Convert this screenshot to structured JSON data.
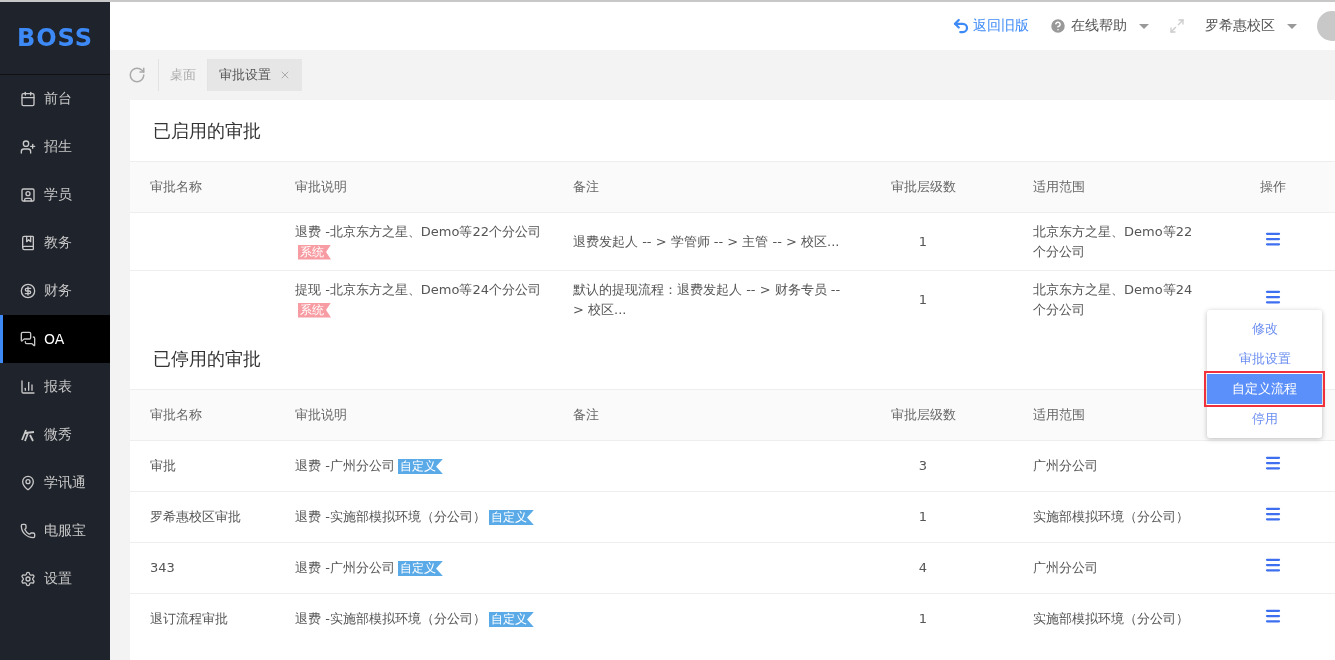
{
  "logo": "BOSS",
  "sidebar": {
    "items": [
      {
        "label": "前台",
        "selected": false
      },
      {
        "label": "招生",
        "selected": false
      },
      {
        "label": "学员",
        "selected": false
      },
      {
        "label": "教务",
        "selected": false
      },
      {
        "label": "财务",
        "selected": false
      },
      {
        "label": "OA",
        "selected": true
      },
      {
        "label": "报表",
        "selected": false
      },
      {
        "label": "微秀",
        "selected": false
      },
      {
        "label": "学讯通",
        "selected": false
      },
      {
        "label": "电服宝",
        "selected": false
      },
      {
        "label": "设置",
        "selected": false
      }
    ]
  },
  "topbar": {
    "back_link": "返回旧版",
    "help": "在线帮助",
    "campus": "罗希惠校区"
  },
  "tabs": [
    {
      "label": "桌面",
      "selected": false,
      "closable": false
    },
    {
      "label": "审批设置",
      "selected": true,
      "closable": true
    }
  ],
  "sections": [
    {
      "title": "已启用的审批",
      "columns": [
        "审批名称",
        "审批说明",
        "备注",
        "审批层级数",
        "适用范围",
        "操作"
      ],
      "rows": [
        {
          "description": "退费 -北京东方之星、Demo等22个分公司",
          "tag": {
            "text": "系统",
            "kind": "system"
          },
          "remark": "退费发起人 -- > 学管师 -- > 主管 -- > 校区...",
          "levels": "1",
          "scope": "北京东方之星、Demo等22个分公司"
        },
        {
          "description": "提现 -北京东方之星、Demo等24个分公司",
          "tag": {
            "text": "系统",
            "kind": "system"
          },
          "remark": "默认的提现流程：退费发起人 -- > 财务专员 --> 校区...",
          "levels": "1",
          "scope": "北京东方之星、Demo等24个分公司"
        }
      ]
    },
    {
      "title": "已停用的审批",
      "columns": [
        "审批名称",
        "审批说明",
        "备注",
        "审批层级数",
        "适用范围"
      ],
      "rows": [
        {
          "name": "审批",
          "description": "退费 -广州分公司",
          "tag": {
            "text": "自定义",
            "kind": "custom"
          },
          "levels": "3",
          "scope": "广州分公司"
        },
        {
          "name": "罗希惠校区审批",
          "description": "退费 -实施部模拟环境（分公司）",
          "tag": {
            "text": "自定义",
            "kind": "custom"
          },
          "levels": "1",
          "scope": "实施部模拟环境（分公司）"
        },
        {
          "name": "343",
          "description": "退费 -广州分公司",
          "tag": {
            "text": "自定义",
            "kind": "custom"
          },
          "levels": "4",
          "scope": "广州分公司"
        },
        {
          "name": "退订流程审批",
          "description": "退费 -实施部模拟环境（分公司）",
          "tag": {
            "text": "自定义",
            "kind": "custom"
          },
          "levels": "1",
          "scope": "实施部模拟环境（分公司）"
        }
      ]
    }
  ],
  "action_menu": {
    "items": [
      {
        "label": "修改",
        "selected": false
      },
      {
        "label": "审批设置",
        "selected": false
      },
      {
        "label": "自定义流程",
        "selected": true
      },
      {
        "label": "停用",
        "selected": false
      }
    ]
  }
}
